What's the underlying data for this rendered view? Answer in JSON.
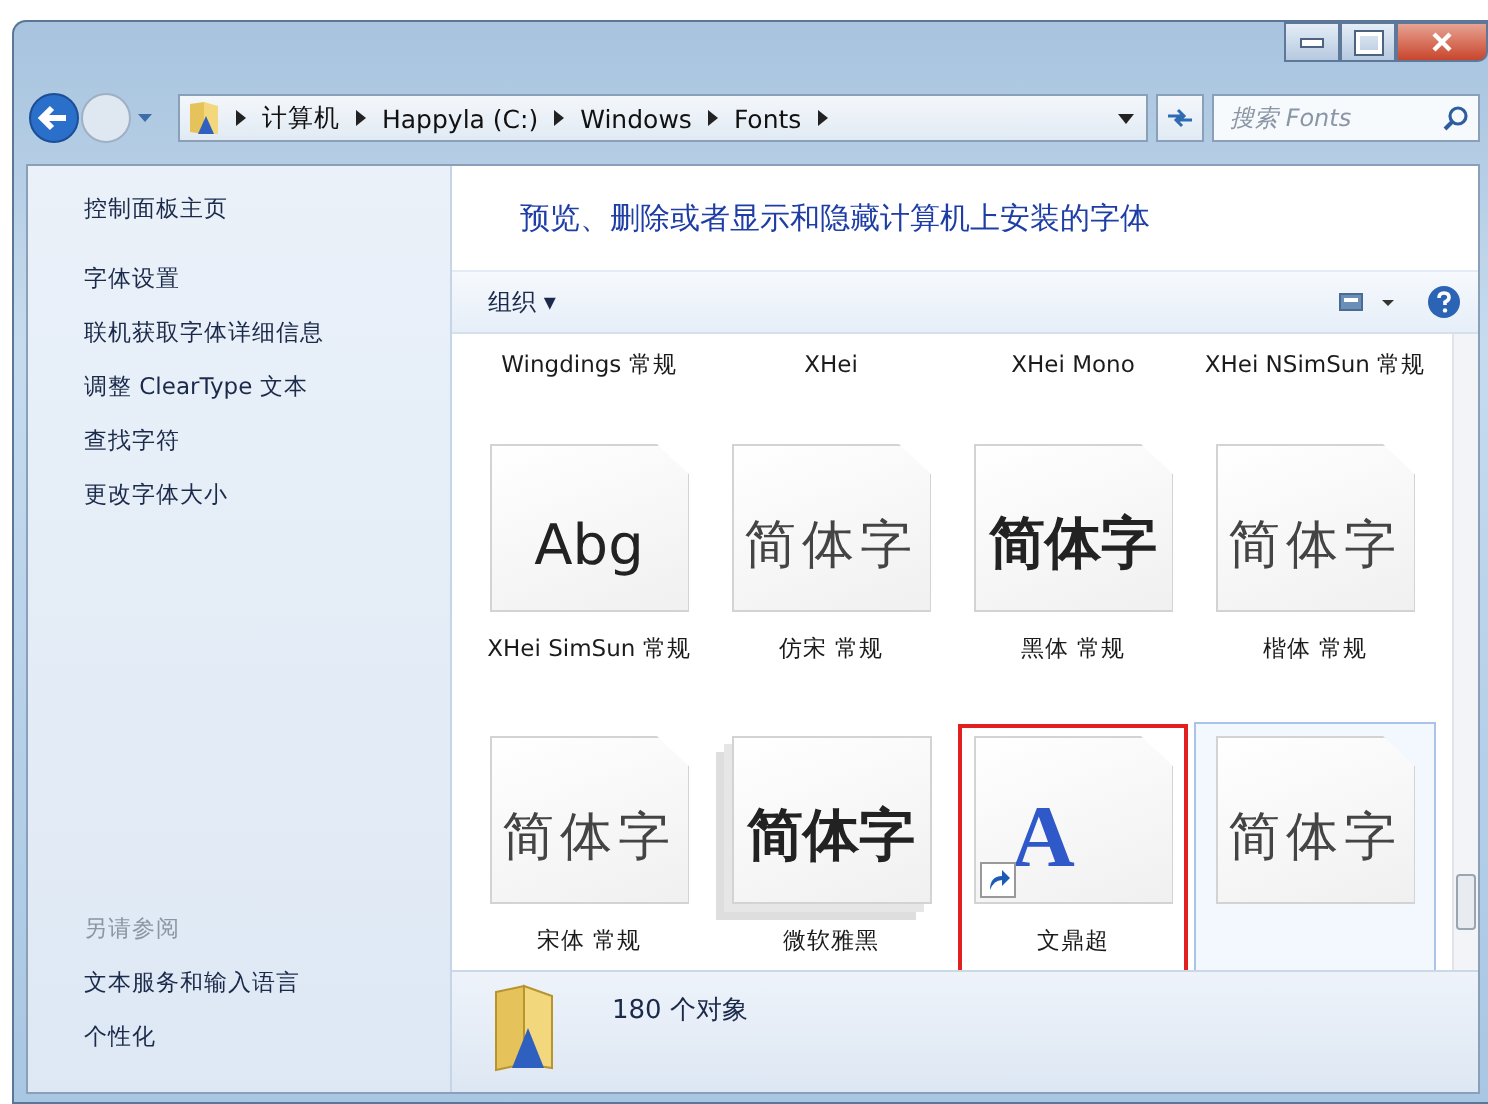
{
  "address_bar": {
    "segments": [
      "计算机",
      "Happyla (C:)",
      "Windows",
      "Fonts"
    ]
  },
  "search": {
    "placeholder": "搜索 Fonts"
  },
  "sidebar": {
    "items": [
      {
        "label": "控制面板主页",
        "kind": "link"
      },
      {
        "label": "字体设置",
        "kind": "link"
      },
      {
        "label": "联机获取字体详细信息",
        "kind": "link"
      },
      {
        "label": "调整 ClearType 文本",
        "kind": "link"
      },
      {
        "label": "查找字符",
        "kind": "link"
      },
      {
        "label": "更改字体大小",
        "kind": "link"
      }
    ],
    "see_also": {
      "heading": "另请参阅",
      "items": [
        "文本服务和输入语言",
        "个性化"
      ]
    }
  },
  "content": {
    "title": "预览、删除或者显示和隐藏计算机上安装的字体",
    "toolbar": {
      "organize": "组织 ▾"
    }
  },
  "fonts": [
    {
      "kind": "cut",
      "label": "Wingdings 常规",
      "selected": false,
      "annotated": false
    },
    {
      "kind": "cut",
      "label": "XHei",
      "selected": false,
      "annotated": false
    },
    {
      "kind": "cut",
      "label": "XHei Mono",
      "selected": false,
      "annotated": false
    },
    {
      "kind": "cut",
      "label": "XHei NSimSun 常规",
      "selected": false,
      "annotated": false
    },
    {
      "kind": "latin",
      "preview": "Abg",
      "label": "XHei SimSun 常规",
      "selected": false,
      "annotated": false
    },
    {
      "kind": "light",
      "preview": "简体字",
      "label": "仿宋 常规",
      "selected": false,
      "annotated": false
    },
    {
      "kind": "bold",
      "preview": "简体字",
      "label": "黑体 常规",
      "selected": false,
      "annotated": false
    },
    {
      "kind": "light",
      "preview": "简体字",
      "label": "楷体 常规",
      "selected": false,
      "annotated": false
    },
    {
      "kind": "light",
      "preview": "简体字",
      "label": "宋体 常规",
      "selected": false,
      "annotated": false
    },
    {
      "kind": "family",
      "preview": "简体字",
      "label": "微软雅黑",
      "selected": false,
      "annotated": false
    },
    {
      "kind": "shortcut",
      "preview": "A",
      "label": "文鼎超",
      "selected": false,
      "annotated": true
    },
    {
      "kind": "light",
      "preview": "简体字",
      "selected": true,
      "annotated": false
    }
  ],
  "status_bar": {
    "count": "180 个对象"
  }
}
